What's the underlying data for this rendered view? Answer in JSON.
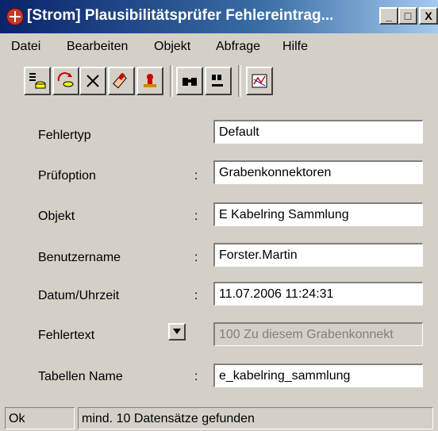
{
  "window": {
    "title": "[Strom] Plausibilitätsprüfer Fehlereintrag...",
    "minimize": "_",
    "maximize": "□",
    "close": "X"
  },
  "menu": [
    "Datei",
    "Bearbeiten",
    "Objekt",
    "Abfrage",
    "Hilfe"
  ],
  "form": {
    "fehlertyp": {
      "label": "Fehlertyp",
      "colon": "",
      "value": "Default"
    },
    "pruefoption": {
      "label": "Prüfoption",
      "colon": ":",
      "value": "Grabenkonnektoren"
    },
    "objekt": {
      "label": "Objekt",
      "colon": ":",
      "value": "E Kabelring Sammlung"
    },
    "benutzername": {
      "label": "Benutzername",
      "colon": ":",
      "value": "Forster.Martin"
    },
    "datum": {
      "label": "Datum/Uhrzeit",
      "colon": ":",
      "value": "11.07.2006 11:24:31"
    },
    "fehlertext": {
      "label": "Fehlertext",
      "colon": "",
      "value": "100 Zu diesem Grabenkonnekt"
    },
    "tabellen": {
      "label": "Tabellen Name",
      "colon": ":",
      "value": "e_kabelring_sammlung"
    }
  },
  "status": {
    "state": "Ok",
    "message": "mind. 10 Datensätze gefunden"
  }
}
